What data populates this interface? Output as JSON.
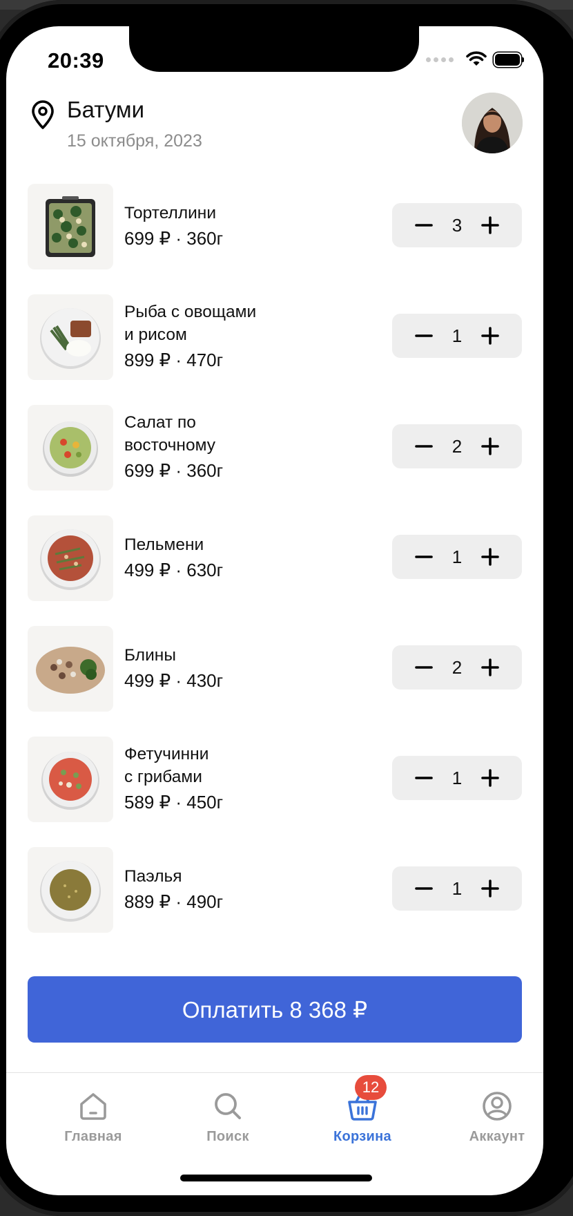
{
  "status_bar": {
    "time": "20:39",
    "icons": [
      "signal-dots-icon",
      "wifi-icon",
      "battery-icon"
    ]
  },
  "header": {
    "city": "Батуми",
    "date": "15 октября, 2023",
    "location_icon": "location-pin-icon",
    "avatar": "user-avatar"
  },
  "cart": {
    "items": [
      {
        "name": "Тортеллини",
        "price": "699 ₽ · 360г",
        "qty": "3",
        "image": "tortellini-tray"
      },
      {
        "name": "Рыба с овощами\nи рисом",
        "price": "899 ₽ · 470г",
        "qty": "1",
        "image": "fish-plate"
      },
      {
        "name": "Салат по\nвосточному",
        "price": "699 ₽ · 360г",
        "qty": "2",
        "image": "salad-bowl"
      },
      {
        "name": "Пельмени",
        "price": "499 ₽ · 630г",
        "qty": "1",
        "image": "pelmeni-plate"
      },
      {
        "name": "Блины",
        "price": "499 ₽ · 430г",
        "qty": "2",
        "image": "bliny-board"
      },
      {
        "name": "Фетучинни\nс грибами",
        "price": "589 ₽ · 450г",
        "qty": "1",
        "image": "fettuccine-bowl"
      },
      {
        "name": "Паэлья",
        "price": "889 ₽ · 490г",
        "qty": "1",
        "image": "paella-soup-bowl"
      }
    ]
  },
  "pay_button": {
    "label": "Оплатить 8 368 ₽"
  },
  "tabbar": {
    "tabs": [
      {
        "label": "Главная",
        "icon": "home-icon",
        "active": false
      },
      {
        "label": "Поиск",
        "icon": "search-icon",
        "active": false
      },
      {
        "label": "Корзина",
        "icon": "basket-icon",
        "active": true,
        "badge": "12"
      },
      {
        "label": "Аккаунт",
        "icon": "account-icon",
        "active": false
      }
    ]
  },
  "colors": {
    "accent": "#4065d8",
    "active_tab": "#3b73d9",
    "badge": "#e74c3c",
    "muted": "#8c8c8c"
  }
}
